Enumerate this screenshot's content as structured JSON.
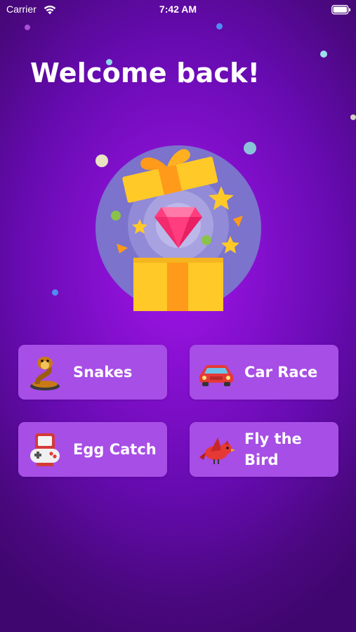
{
  "status_bar": {
    "carrier": "Carrier",
    "time": "7:42 AM",
    "wifi_icon": "wifi-icon",
    "battery_icon": "battery-icon"
  },
  "header": {
    "title": "Welcome back!"
  },
  "hero": {
    "illustration": "gift-box-with-diamond"
  },
  "games": [
    {
      "label": "Snakes",
      "icon": "cobra-icon"
    },
    {
      "label": "Car Race",
      "icon": "red-car-icon"
    },
    {
      "label": "Egg Catch",
      "icon": "game-controller-icon"
    },
    {
      "label": "Fly the Bird",
      "icon": "red-bird-icon"
    }
  ],
  "colors": {
    "background": "#8510cf",
    "button": "#a74ee6",
    "text": "#ffffff"
  }
}
